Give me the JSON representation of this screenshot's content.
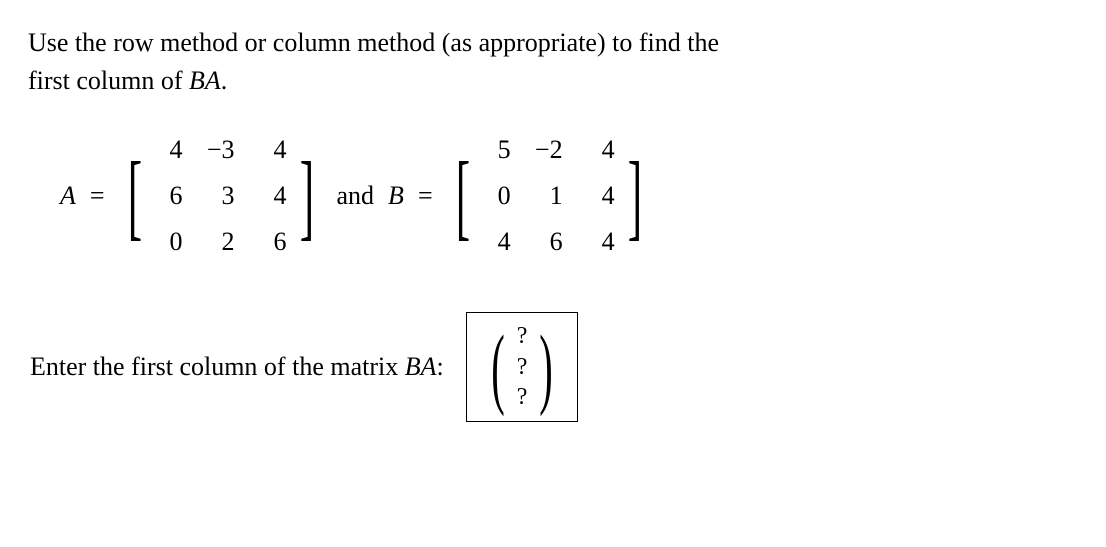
{
  "prompt": {
    "line1": "Use the row method or column method (as appropriate) to find the",
    "line2_prefix": "first column of ",
    "line2_var": "BA",
    "line2_suffix": "."
  },
  "matrices": {
    "A_label": "A",
    "eq": "=",
    "A": {
      "r0c0": "4",
      "r0c1": "−3",
      "r0c2": "4",
      "r1c0": "6",
      "r1c1": "3",
      "r1c2": "4",
      "r2c0": "0",
      "r2c1": "2",
      "r2c2": "6"
    },
    "and": "and",
    "B_label": "B",
    "B": {
      "r0c0": "5",
      "r0c1": "−2",
      "r0c2": "4",
      "r1c0": "0",
      "r1c1": "1",
      "r1c2": "4",
      "r2c0": "4",
      "r2c1": "6",
      "r2c2": "4"
    }
  },
  "answer": {
    "prompt_prefix": "Enter the first column of the matrix ",
    "prompt_var": "BA",
    "prompt_suffix": ":",
    "placeholder1": "?",
    "placeholder2": "?",
    "placeholder3": "?"
  }
}
